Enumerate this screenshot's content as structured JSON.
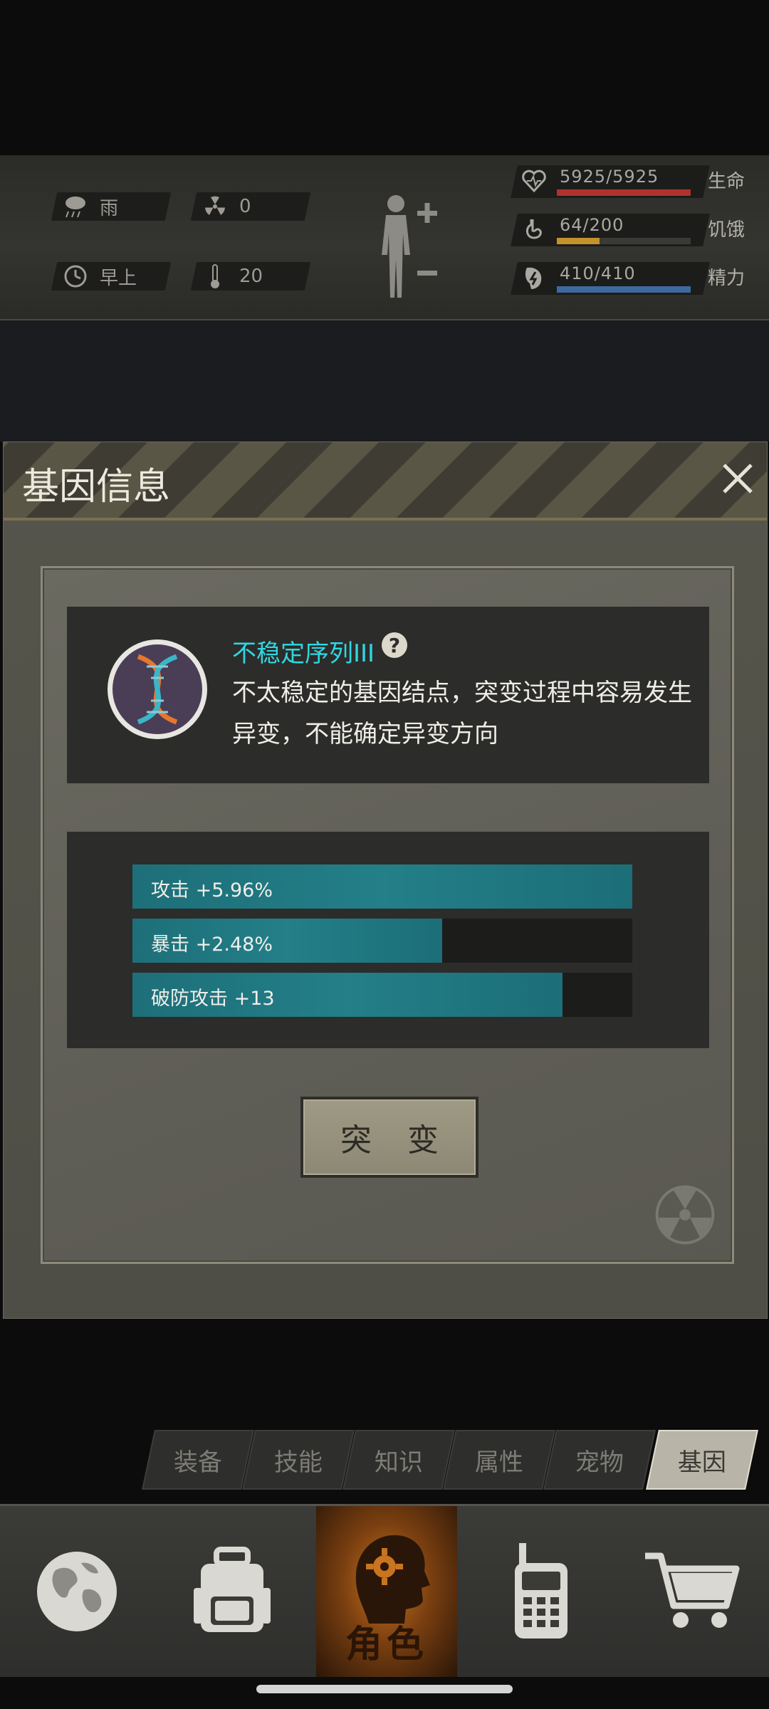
{
  "status": {
    "weather": "雨",
    "radiation": "0",
    "time_of_day": "早上",
    "temperature": "20"
  },
  "vitals": [
    {
      "name": "生命",
      "value": "5925/5925",
      "fraction": 1.0,
      "color": "#b0322c",
      "icon": "heart-icon"
    },
    {
      "name": "饥饿",
      "value": "64/200",
      "fraction": 0.32,
      "color": "#c4922a",
      "icon": "stomach-icon"
    },
    {
      "name": "精力",
      "value": "410/410",
      "fraction": 1.0,
      "color": "#3c6aa0",
      "icon": "energy-icon"
    }
  ],
  "dialog": {
    "title": "基因信息",
    "gene_name": "不稳定序列III",
    "gene_description": "不太稳定的基因结点，突变过程中容易发生异变，不能确定异变方向",
    "stats": [
      {
        "label": "攻击 +5.96%",
        "fill": 1.0
      },
      {
        "label": "暴击 +2.48%",
        "fill": 0.62
      },
      {
        "label": "破防攻击 +13",
        "fill": 0.86
      }
    ],
    "mutate_button": "突 变"
  },
  "tabs": [
    {
      "label": "装备",
      "active": false
    },
    {
      "label": "技能",
      "active": false
    },
    {
      "label": "知识",
      "active": false
    },
    {
      "label": "属性",
      "active": false
    },
    {
      "label": "宠物",
      "active": false
    },
    {
      "label": "基因",
      "active": true
    }
  ],
  "bottom_nav": {
    "character_label": "角色",
    "items": [
      "globe-icon",
      "backpack-icon",
      "character-icon",
      "radio-icon",
      "cart-icon"
    ]
  },
  "colors": {
    "accent_cyan": "#2fd7e2",
    "stat_fill": "#237f88"
  }
}
